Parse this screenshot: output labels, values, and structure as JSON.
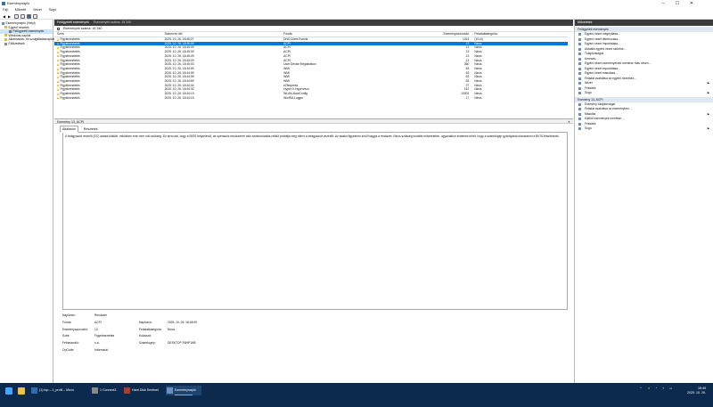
{
  "window": {
    "title": "Eseménynapló",
    "minimize": "–",
    "maximize": "☐",
    "close": "✕"
  },
  "menu": [
    "Fájl",
    "Művelet",
    "Nézet",
    "Súgó"
  ],
  "tree": [
    {
      "label": "Eseménynapló (Helyi)",
      "level": 0
    },
    {
      "label": "Egyéni nézetek",
      "level": 1
    },
    {
      "label": "Felügyeleti események",
      "level": 2,
      "selected": true
    },
    {
      "label": "Windows-naplók",
      "level": 1
    },
    {
      "label": "Alkalmazás- és szolgáltatásnaplók",
      "level": 1
    },
    {
      "label": "Előfizetések",
      "level": 1
    }
  ],
  "center": {
    "title": "Felügyeleti események",
    "count_label": "Események száma: 18 340",
    "filter_label": "Események száma: 18 340",
    "columns": [
      "Szint",
      "Dátum és idő",
      "Forrás",
      "Eseményazonosító",
      "Feladatkategória"
    ],
    "rows": [
      [
        "Figyelmeztetés",
        "2025. 10. 26. 18:45:27",
        "DNS Client Events",
        "1014",
        "(1014)"
      ],
      [
        "Figyelmeztetés",
        "2025. 10. 26. 18:45:09",
        "ACPI",
        "13",
        "Nincs"
      ],
      [
        "Figyelmeztetés",
        "2025. 10. 26. 18:45:09",
        "ACPI",
        "13",
        "Nincs"
      ],
      [
        "Figyelmeztetés",
        "2025. 10. 26. 18:45:09",
        "ACPI",
        "13",
        "Nincs"
      ],
      [
        "Figyelmeztetés",
        "2025. 10. 26. 18:45:09",
        "ACPI",
        "13",
        "Nincs"
      ],
      [
        "Figyelmeztetés",
        "2025. 10. 26. 18:45:09",
        "ACPI",
        "13",
        "Nincs"
      ],
      [
        "Figyelmeztetés",
        "2025. 10. 26. 18:45:03",
        "User Device Registration",
        "360",
        "Nincs"
      ],
      [
        "Figyelmeztetés",
        "2025. 10. 26. 18:44:59",
        "WMI",
        "63",
        "Nincs"
      ],
      [
        "Figyelmeztetés",
        "2025. 10. 26. 18:44:59",
        "WMI",
        "63",
        "Nincs"
      ],
      [
        "Figyelmeztetés",
        "2025. 10. 26. 18:44:59",
        "WMI",
        "63",
        "Nincs"
      ],
      [
        "Figyelmeztetés",
        "2025. 10. 26. 18:44:59",
        "WMI",
        "63",
        "Nincs"
      ],
      [
        "Figyelmeztetés",
        "2025. 10. 26. 18:44:44",
        "e2fexpress",
        "27",
        "Nincs"
      ],
      [
        "Figyelmeztetés",
        "2025. 10. 26. 18:44:30",
        "Hyper-V-Hypervisor",
        "167",
        "Nincs"
      ],
      [
        "Figyelmeztetés",
        "2025. 10. 26. 18:44:19",
        "WLAN-AutoConfig",
        "10002",
        "Nincs"
      ],
      [
        "Figyelmeztetés",
        "2025. 10. 26. 18:44:15",
        "WinRM-Logger",
        "17",
        "Nincs"
      ]
    ],
    "selected_row": 1
  },
  "detail": {
    "header": "Esemény 13, ACPI",
    "close": "✕",
    "tabs": [
      "Általános",
      "Részletek"
    ],
    "description": "A beágyazott vezérlő (EC) adatot küldött, miközben erre nem volt szükség. Ez arra utal, hogy a BIOS helytelenül, az operációs rendszerrel való szinkronizálás nélkül próbálja meg elérni a beágyazott vezérlőt. Az adatot figyelmen kívül hagyja a rendszer. Nincs szükség további műveletekre, ugyanakkor érdemes lehet, hogy a számítógép gyártójánál utánanézni a BIOS-frissítésnek.",
    "props": {
      "naplonev_label": "Naplónév:",
      "naplonev": "Rendszer",
      "forras_label": "Forrás:",
      "forras": "ACPI",
      "naplozva_label": "Naplózva:",
      "naplozva": "2025. 10. 26. 18:45:09",
      "azon_label": "Eseményazonosító:",
      "azon": "13",
      "feladat_label": "Feladatkategória:",
      "feladat": "Nincs",
      "szint_label": "Szint:",
      "szint": "Figyelmeztetés",
      "kulcs_label": "Kulcsszó:",
      "kulcs": "",
      "felh_label": "Felhasználó:",
      "felh": "n.a.",
      "szg_label": "Számítógép:",
      "szg": "DESKTOP-F6HP1HB",
      "opcode_label": "OpCode:",
      "opcode": "Információ"
    }
  },
  "actions": {
    "title": "Műveletek",
    "section1": "Felügyeleti események",
    "items1": [
      {
        "label": "Egyéni nézet megnyitása...",
        "icon": "folder-icon"
      },
      {
        "label": "Egyéni nézet létrehozása...",
        "icon": "filter-icon"
      },
      {
        "label": "Egyéni nézet importálása...",
        "icon": "import-icon"
      },
      {
        "label": "Aktuális egyéni nézet szűrése...",
        "icon": "filter-icon"
      },
      {
        "label": "Tulajdonságok",
        "icon": "properties-icon"
      },
      {
        "label": "Keresés...",
        "icon": "binoculars-icon"
      },
      {
        "label": "Egyéni nézet eseményeinek mentése más néven...",
        "icon": "save-icon"
      },
      {
        "label": "Egyéni nézet exportálása...",
        "icon": "export-icon"
      },
      {
        "label": "Egyéni nézet másolása...",
        "icon": "copy-icon"
      },
      {
        "label": "Feladat csatolása az egyéni nézethez...",
        "icon": "task-icon"
      },
      {
        "label": "Nézet",
        "icon": "view-icon",
        "arrow": true
      },
      {
        "label": "Frissítés",
        "icon": "refresh-icon"
      },
      {
        "label": "Súgó",
        "icon": "help-icon",
        "arrow": true
      }
    ],
    "section2": "Esemény 13, ACPI",
    "items2": [
      {
        "label": "Esemény tulajdonságai",
        "icon": "properties-icon"
      },
      {
        "label": "Feladat csatolása az eseményhez...",
        "icon": "task-icon"
      },
      {
        "label": "Másolás",
        "icon": "copy-icon",
        "arrow": true
      },
      {
        "label": "Kijelölt események mentése...",
        "icon": "save-icon"
      },
      {
        "label": "Frissítés",
        "icon": "refresh-icon"
      },
      {
        "label": "Súgó",
        "icon": "help-icon",
        "arrow": true
      }
    ]
  },
  "taskbar": {
    "apps": [
      {
        "label": "(1) top – 1_profil – Micro",
        "color": "#2b6cb0"
      },
      {
        "label": "1 Connect3",
        "color": "#888888"
      },
      {
        "label": "Hard Disk Sentinel",
        "color": "#b03a2e"
      },
      {
        "label": "Eseménynapló",
        "color": "#6b8fbf",
        "active": true
      }
    ],
    "time": "18:45",
    "date": "2025. 10. 26."
  }
}
